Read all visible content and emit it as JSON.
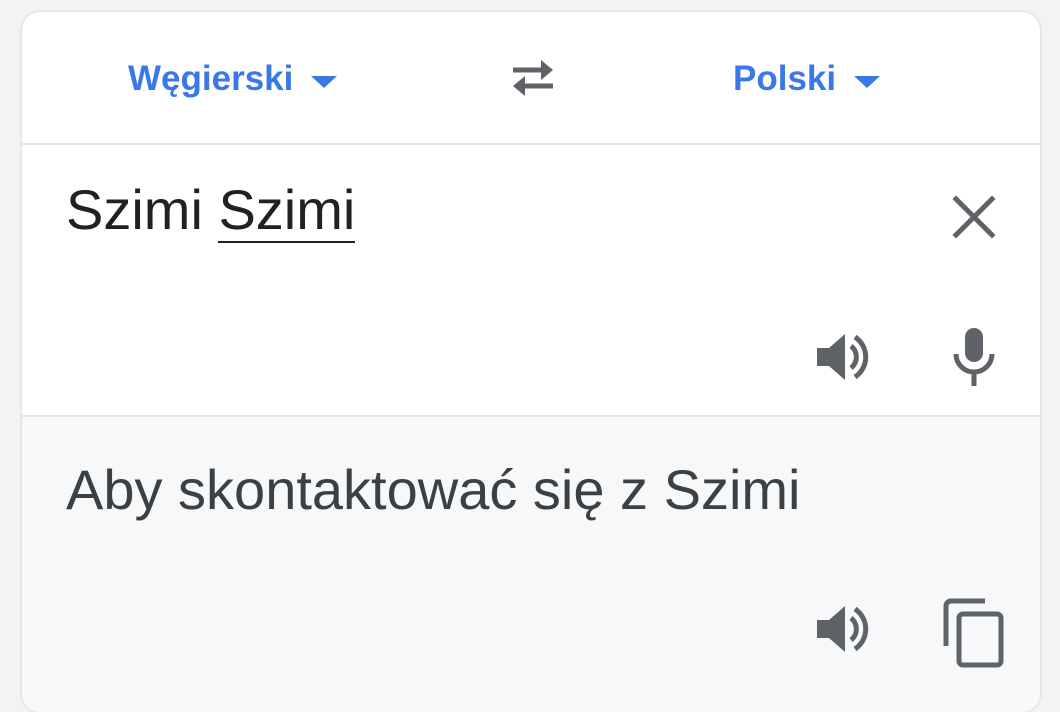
{
  "languages": {
    "source": "Węgierski",
    "target": "Polski"
  },
  "source": {
    "text_part1": "Szimi ",
    "text_part2": "Szimi"
  },
  "translation": {
    "text": "Aby skontaktować się z Szimi"
  },
  "icons": {
    "swap": "swap-arrows-icon",
    "clear": "close-icon",
    "source_speaker": "speaker-icon",
    "microphone": "microphone-icon",
    "target_speaker": "speaker-icon",
    "copy": "copy-icon"
  },
  "colors": {
    "accent": "#3b78e7",
    "icon": "#5f6368",
    "source_text": "#202124",
    "translation_text": "#3c4043",
    "translation_bg": "#f7f8fa"
  }
}
